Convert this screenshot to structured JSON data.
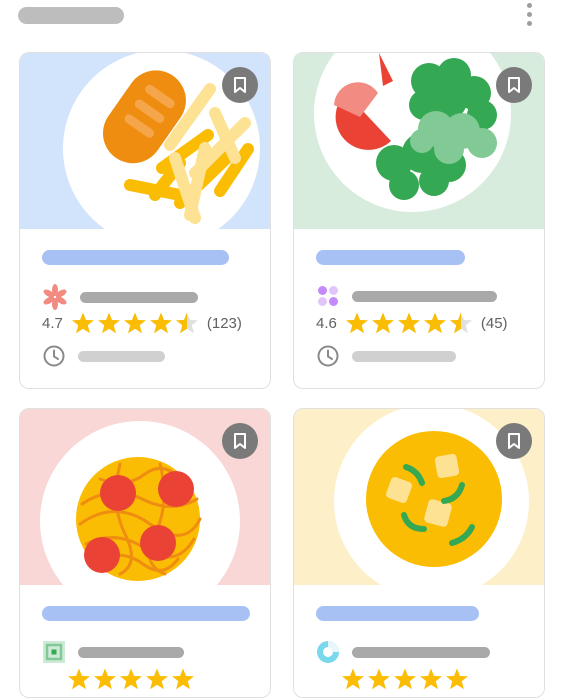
{
  "screen": {
    "header": {
      "menu_icon": "more-vert-icon"
    },
    "cards": [
      {
        "dish": "chicken-and-fries",
        "bg_color": "#d2e3fc",
        "rating": "4.7",
        "stars": 4.5,
        "review_count": "(123)",
        "source_icon": "pink-flower-logo-icon"
      },
      {
        "dish": "salad",
        "bg_color": "#d7ecdd",
        "rating": "4.6",
        "stars": 4.5,
        "review_count": "(45)",
        "source_icon": "purple-dots-logo-icon"
      },
      {
        "dish": "spaghetti-and-meatballs",
        "bg_color": "#f8d7d6",
        "source_icon": "green-square-logo-icon"
      },
      {
        "dish": "soup",
        "bg_color": "#fdefc8",
        "source_icon": "cyan-ring-logo-icon"
      }
    ],
    "colors": {
      "star": "#fbbc04",
      "bookmark": "#7a7a7a",
      "title_bar": "#a7c1f4",
      "placeholder": "#a9a9a9"
    }
  }
}
